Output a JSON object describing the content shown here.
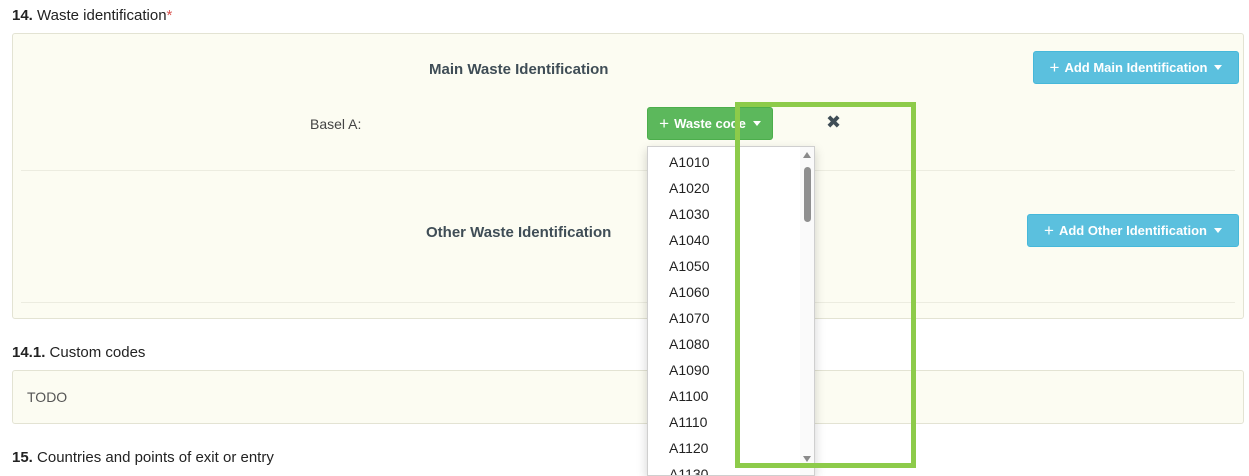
{
  "section14": {
    "number": "14.",
    "title": "Waste identification",
    "required_mark": "*"
  },
  "main": {
    "heading": "Main Waste Identification",
    "add_button": "Add Main Identification",
    "basel_label": "Basel A:",
    "waste_code_button": "Waste code",
    "remove_symbol": "✖"
  },
  "other": {
    "heading": "Other Waste Identification",
    "add_button": "Add Other Identification"
  },
  "dropdown": {
    "items": [
      "A1010",
      "A1020",
      "A1030",
      "A1040",
      "A1050",
      "A1060",
      "A1070",
      "A1080",
      "A1090",
      "A1100",
      "A1110",
      "A1120",
      "A1130"
    ]
  },
  "section14_1": {
    "number": "14.1.",
    "title": "Custom codes",
    "content": "TODO"
  },
  "section15": {
    "number": "15.",
    "title": "Countries and points of exit or entry"
  },
  "colors": {
    "info_button": "#5bc0de",
    "success_button": "#5cb85c",
    "highlight": "#8dcb4a",
    "panel_background": "#fcfcf2",
    "required": "#d9534f"
  }
}
